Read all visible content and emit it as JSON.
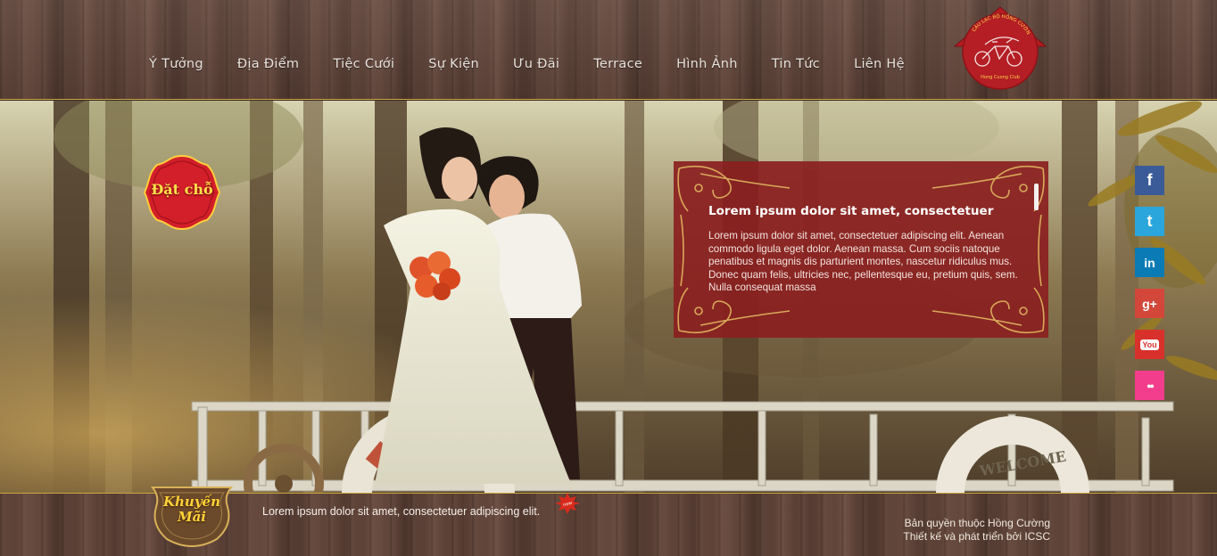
{
  "nav": {
    "items": [
      "Ý Tưởng",
      "Địa Điểm",
      "Tiệc Cưới",
      "Sự Kiện",
      "Ưu Đãi",
      "Terrace",
      "Hình Ảnh",
      "Tin Tức",
      "Liên Hệ"
    ]
  },
  "logo": {
    "top_text": "CÂU LẠC BỘ HỒNG CƯỜNG",
    "bottom_text": "Hong Cuong Club"
  },
  "book_badge": {
    "label": "Đặt chỗ"
  },
  "info_box": {
    "title": "Lorem ipsum dolor sit amet, consectetuer",
    "body": "Lorem ipsum dolor sit amet, consectetuer adipiscing elit. Aenean commodo ligula eget dolor. Aenean massa. Cum sociis natoque penatibus et magnis dis parturient montes, nascetur ridiculus mus. Donec quam felis, ultricies nec, pellentesque eu, pretium quis, sem. Nulla consequat massa"
  },
  "hero": {
    "lifebuoy_text": "WELCOME"
  },
  "social": [
    {
      "name": "facebook",
      "glyph": "f",
      "color": "#3b5b98"
    },
    {
      "name": "twitter",
      "glyph": "t",
      "color": "#2aa6dc"
    },
    {
      "name": "linkedin",
      "glyph": "in",
      "color": "#0b7bb5"
    },
    {
      "name": "google-plus",
      "glyph": "g+",
      "color": "#d3473a"
    },
    {
      "name": "youtube",
      "glyph": "You",
      "color": "#d8312c"
    },
    {
      "name": "flickr",
      "glyph": "●●",
      "color": "#f23d8c"
    }
  ],
  "footer": {
    "promo_label_1": "Khuyến",
    "promo_label_2": "Mãi",
    "promo_text": "Lorem ipsum dolor sit amet, consectetuer adipiscing elit.",
    "new_label": "new",
    "copyright_1": "Bản quyền thuộc Hồng Cường",
    "copyright_2": "Thiết kế và phát triển bởi ICSC"
  }
}
